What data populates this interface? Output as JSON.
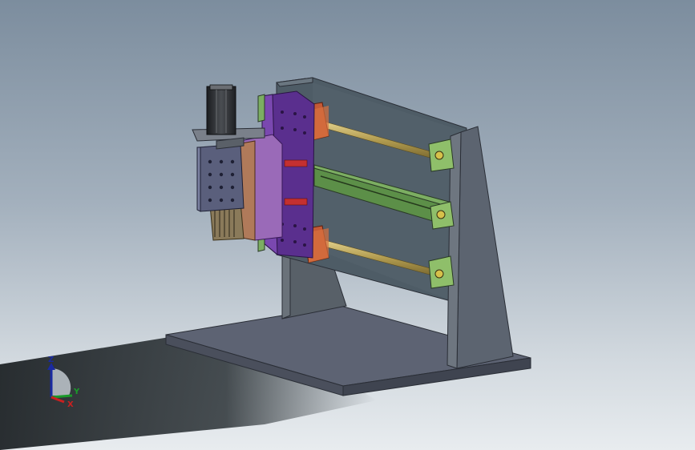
{
  "viewport": {
    "background_top": "#7c8d9e",
    "background_bottom": "#e8ecef",
    "shadow_color": "#1f2427"
  },
  "model": {
    "base_color": "#5d6373",
    "frame_color": "#4e5c66",
    "carriage_color": "#5a2f8e",
    "rail_color": "#5c8f48",
    "rod_color": "#b8a45a",
    "block_color": "#c45a36",
    "motor_color": "#2d2f33"
  },
  "triad": {
    "z_label": "Z",
    "y_label": "Y",
    "x_label": "X",
    "z_color": "#1a2aa0",
    "y_color": "#1a9a2a",
    "x_color": "#c82020"
  }
}
